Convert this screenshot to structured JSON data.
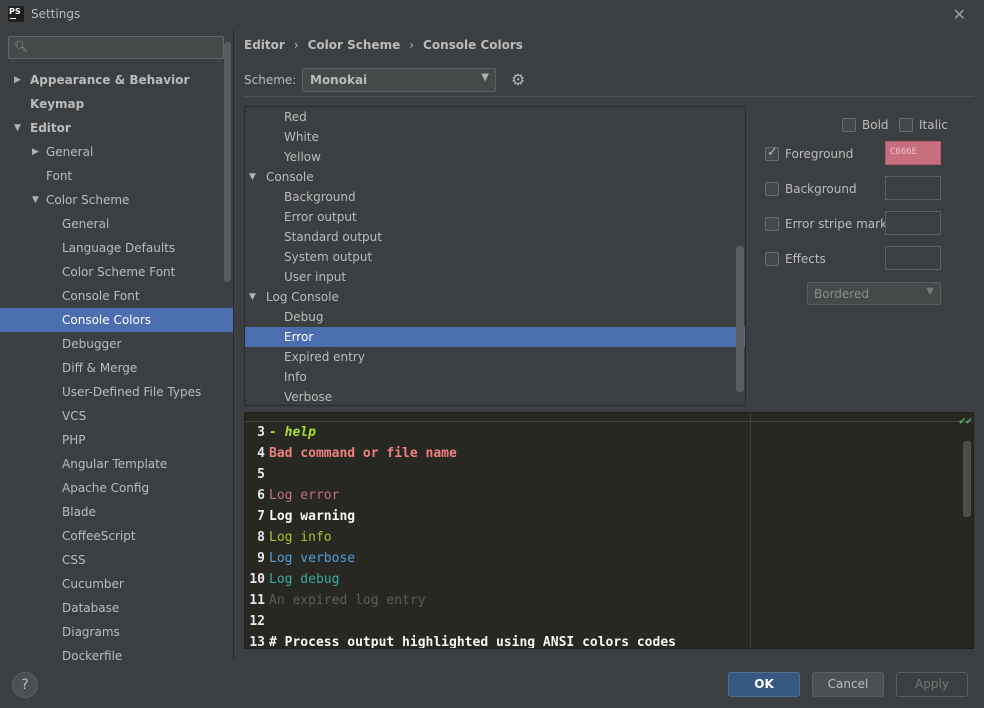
{
  "window": {
    "title": "Settings",
    "app_icon_text": "PS"
  },
  "search": {
    "placeholder": ""
  },
  "sidebar": {
    "items": [
      {
        "label": "Appearance & Behavior",
        "arrow": "▶",
        "level": 0,
        "bold": true
      },
      {
        "label": "Keymap",
        "arrow": "",
        "level": 0,
        "bold": true
      },
      {
        "label": "Editor",
        "arrow": "▼",
        "level": 0,
        "bold": true
      },
      {
        "label": "General",
        "arrow": "▶",
        "level": 1,
        "bold": false
      },
      {
        "label": "Font",
        "arrow": "",
        "level": 1,
        "bold": false
      },
      {
        "label": "Color Scheme",
        "arrow": "▼",
        "level": 1,
        "bold": false
      },
      {
        "label": "General",
        "arrow": "",
        "level": 2,
        "bold": false
      },
      {
        "label": "Language Defaults",
        "arrow": "",
        "level": 2,
        "bold": false
      },
      {
        "label": "Color Scheme Font",
        "arrow": "",
        "level": 2,
        "bold": false
      },
      {
        "label": "Console Font",
        "arrow": "",
        "level": 2,
        "bold": false
      },
      {
        "label": "Console Colors",
        "arrow": "",
        "level": 2,
        "bold": false,
        "selected": true
      },
      {
        "label": "Debugger",
        "arrow": "",
        "level": 2,
        "bold": false
      },
      {
        "label": "Diff & Merge",
        "arrow": "",
        "level": 2,
        "bold": false
      },
      {
        "label": "User-Defined File Types",
        "arrow": "",
        "level": 2,
        "bold": false
      },
      {
        "label": "VCS",
        "arrow": "",
        "level": 2,
        "bold": false
      },
      {
        "label": "PHP",
        "arrow": "",
        "level": 2,
        "bold": false
      },
      {
        "label": "Angular Template",
        "arrow": "",
        "level": 2,
        "bold": false
      },
      {
        "label": "Apache Config",
        "arrow": "",
        "level": 2,
        "bold": false
      },
      {
        "label": "Blade",
        "arrow": "",
        "level": 2,
        "bold": false
      },
      {
        "label": "CoffeeScript",
        "arrow": "",
        "level": 2,
        "bold": false
      },
      {
        "label": "CSS",
        "arrow": "",
        "level": 2,
        "bold": false
      },
      {
        "label": "Cucumber",
        "arrow": "",
        "level": 2,
        "bold": false
      },
      {
        "label": "Database",
        "arrow": "",
        "level": 2,
        "bold": false
      },
      {
        "label": "Diagrams",
        "arrow": "",
        "level": 2,
        "bold": false
      },
      {
        "label": "Dockerfile",
        "arrow": "",
        "level": 2,
        "bold": false
      }
    ]
  },
  "breadcrumb": {
    "part1": "Editor",
    "part2": "Color Scheme",
    "part3": "Console Colors",
    "separator": "›"
  },
  "scheme": {
    "label": "Scheme:",
    "value": "Monokai"
  },
  "attributes": [
    {
      "label": "Red",
      "level": 1
    },
    {
      "label": "White",
      "level": 1
    },
    {
      "label": "Yellow",
      "level": 1
    },
    {
      "label": "Console",
      "level": 0,
      "arrow": "▼"
    },
    {
      "label": "Background",
      "level": 1
    },
    {
      "label": "Error output",
      "level": 1
    },
    {
      "label": "Standard output",
      "level": 1
    },
    {
      "label": "System output",
      "level": 1
    },
    {
      "label": "User input",
      "level": 1
    },
    {
      "label": "Log Console",
      "level": 0,
      "arrow": "▼"
    },
    {
      "label": "Debug",
      "level": 1
    },
    {
      "label": "Error",
      "level": 1,
      "selected": true
    },
    {
      "label": "Expired entry",
      "level": 1
    },
    {
      "label": "Info",
      "level": 1
    },
    {
      "label": "Verbose",
      "level": 1
    }
  ],
  "options": {
    "bold": {
      "label": "Bold",
      "checked": false
    },
    "italic": {
      "label": "Italic",
      "checked": false
    },
    "foreground": {
      "label": "Foreground",
      "checked": true,
      "color_text": "C666E",
      "color": "#c66e7e"
    },
    "background": {
      "label": "Background",
      "checked": false
    },
    "error_stripe": {
      "label": "Error stripe mark",
      "checked": false
    },
    "effects": {
      "label": "Effects",
      "checked": false
    },
    "effects_type": "Bordered"
  },
  "preview": {
    "lines": [
      {
        "num": "3",
        "text": "- help",
        "color": "#a6e22e",
        "style": "italic",
        "weight": "bold"
      },
      {
        "num": "4",
        "text": "Bad command or file name",
        "color": "#f08080",
        "style": "normal",
        "weight": "bold"
      },
      {
        "num": "5",
        "text": "",
        "color": "#e8e8e8",
        "style": "normal",
        "weight": "bold"
      },
      {
        "num": "6",
        "text": "Log error",
        "color": "#c66e7e",
        "style": "normal",
        "weight": "normal"
      },
      {
        "num": "7",
        "text": "Log warning",
        "color": "#f8f8f2",
        "style": "normal",
        "weight": "bold"
      },
      {
        "num": "8",
        "text": "Log info",
        "color": "#a6c22e",
        "style": "normal",
        "weight": "normal"
      },
      {
        "num": "9",
        "text": "Log verbose",
        "color": "#4f9fe0",
        "style": "normal",
        "weight": "normal"
      },
      {
        "num": "10",
        "text": "Log debug",
        "color": "#3aa9a0",
        "style": "normal",
        "weight": "normal"
      },
      {
        "num": "11",
        "text": "An expired log entry",
        "color": "#5e5e56",
        "style": "normal",
        "weight": "normal"
      },
      {
        "num": "12",
        "text": "",
        "color": "#e8e8e8",
        "style": "normal",
        "weight": "bold"
      },
      {
        "num": "13",
        "text": "# Process output highlighted using ANSI colors codes",
        "color": "#f8f8f2",
        "style": "normal",
        "weight": "bold"
      }
    ]
  },
  "footer": {
    "help": "?",
    "ok": "OK",
    "cancel": "Cancel",
    "apply": "Apply"
  },
  "colors": {
    "accent": "#4b6eaf",
    "ok_button": "#365880",
    "background": "#3c3f41",
    "editor_bg": "#272822"
  }
}
